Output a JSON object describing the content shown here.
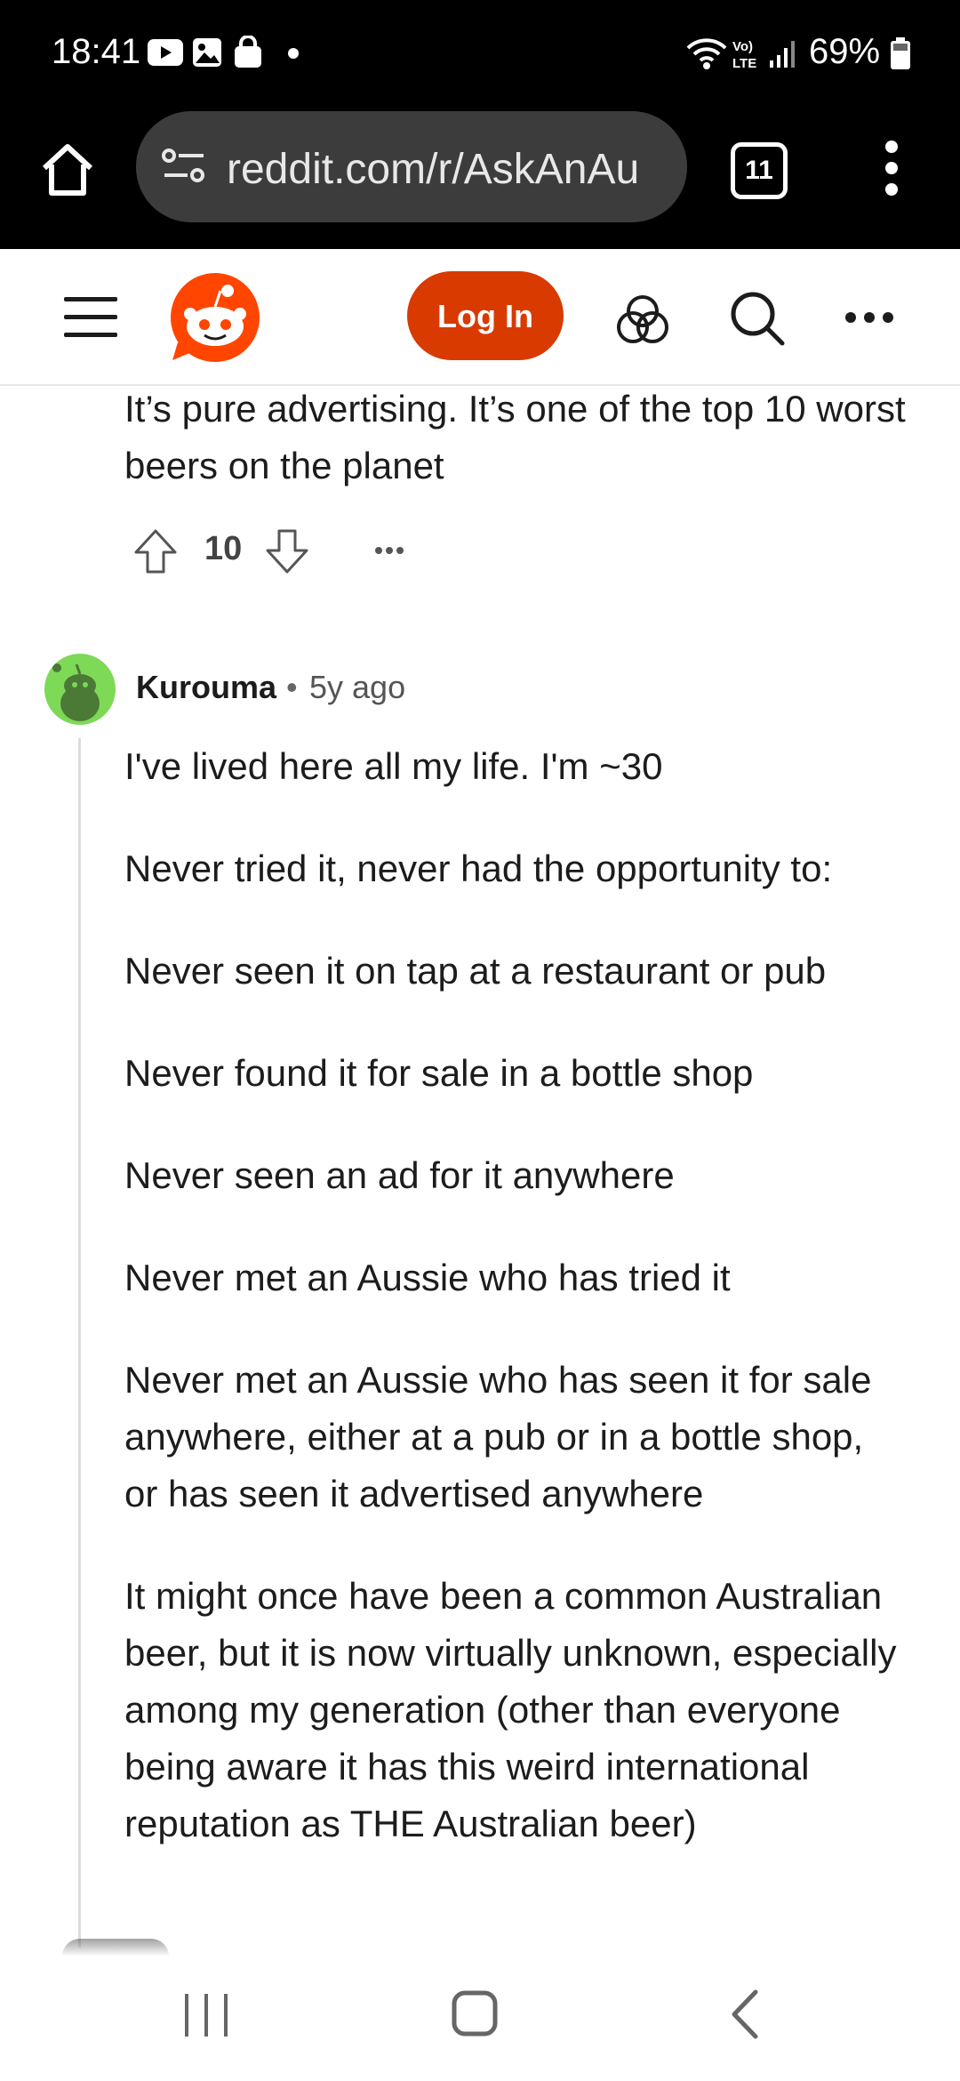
{
  "status_bar": {
    "time": "18:41",
    "battery": "69%",
    "icons": [
      "youtube-icon",
      "gallery-icon",
      "shopping-bag-icon",
      "notification-dot-icon",
      "wifi-icon",
      "volte-icon",
      "signal-icon",
      "battery-icon"
    ]
  },
  "browser": {
    "url": "reddit.com/r/AskAnAu",
    "tab_count": "11"
  },
  "header": {
    "login_label": "Log In"
  },
  "previous_comment": {
    "text": "It’s pure advertising. It’s one of the top 10 worst beers on the planet",
    "votes": "10"
  },
  "comment": {
    "author": "Kurouma",
    "separator": "•",
    "age": "5y ago",
    "paragraphs": [
      "I've lived here all my life. I'm ~30",
      "Never tried it, never had the opportunity to:",
      "Never seen it on tap at a restaurant or pub",
      "Never found it for sale in a bottle shop",
      "Never seen an ad for it anywhere",
      "Never met an Aussie who has tried it",
      "Never met an Aussie who has seen it for sale anywhere, either at a pub or in a bottle shop, or has seen it advertised anywhere",
      "It might once have been a common Australian beer, but it is now virtually unknown, especially among my generation (other than everyone being aware it has this weird international reputation as THE Australian beer)"
    ]
  },
  "colors": {
    "accent": "#d93a00",
    "avatar": "#7ed957"
  }
}
